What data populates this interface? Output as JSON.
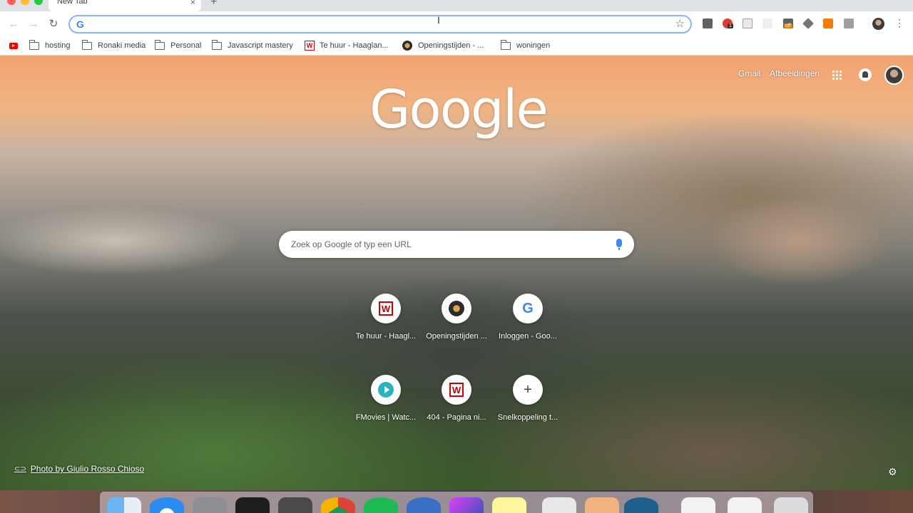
{
  "tab": {
    "title": "New Tab",
    "close": "×",
    "new": "+"
  },
  "toolbar": {
    "back": "←",
    "forward": "→",
    "reload": "↻",
    "omnibox_value": "",
    "g": "G",
    "star": "☆",
    "menu": "⋮",
    "extensions": [
      {
        "name": "json-ext",
        "color": "#5f6368",
        "badge": ""
      },
      {
        "name": "opera-ext",
        "color": "#e53935",
        "badge": "1"
      },
      {
        "name": "code-ext",
        "color": "#9aa0a6",
        "badge": ""
      },
      {
        "name": "blank-ext",
        "color": "#e0e0e0",
        "badge": ""
      },
      {
        "name": "off-ext",
        "color": "#5f6368",
        "badge": "off"
      },
      {
        "name": "cube-ext",
        "color": "#757575",
        "badge": ""
      },
      {
        "name": "chart-ext",
        "color": "#f57c00",
        "badge": ""
      },
      {
        "name": "grid-ext",
        "color": "#9e9e9e",
        "badge": ""
      }
    ]
  },
  "bookmarks": [
    {
      "label": "",
      "icon": "youtube"
    },
    {
      "label": "hosting",
      "icon": "folder"
    },
    {
      "label": "Ronaki media",
      "icon": "folder"
    },
    {
      "label": "Personal",
      "icon": "folder"
    },
    {
      "label": "Javascript mastery",
      "icon": "folder"
    },
    {
      "label": "Te huur - Haaglan...",
      "icon": "w-site"
    },
    {
      "label": "Openingstijden - ...",
      "icon": "o-site"
    },
    {
      "label": "woningen",
      "icon": "folder"
    }
  ],
  "ntp": {
    "logo": "Google",
    "gmail": "Gmail",
    "images": "Afbeeldingen",
    "search_placeholder": "Zoek op Google of typ een URL",
    "tiles": [
      {
        "label": "Te huur - Haagl...",
        "icon": "w-site"
      },
      {
        "label": "Openingstijden ...",
        "icon": "o-site"
      },
      {
        "label": "Inloggen - Goo...",
        "icon": "google"
      },
      {
        "label": "FMovies | Watc...",
        "icon": "play"
      },
      {
        "label": "404 - Pagina ni...",
        "icon": "w-site"
      },
      {
        "label": "Snelkoppeling t...",
        "icon": "plus"
      }
    ],
    "photo_credit": "Photo by Giulio Rosso Chioso",
    "customize": "⚙"
  },
  "icon_glyphs": {
    "w": "W",
    "g": "G",
    "plus": "+",
    "link": "⊂⊃"
  }
}
